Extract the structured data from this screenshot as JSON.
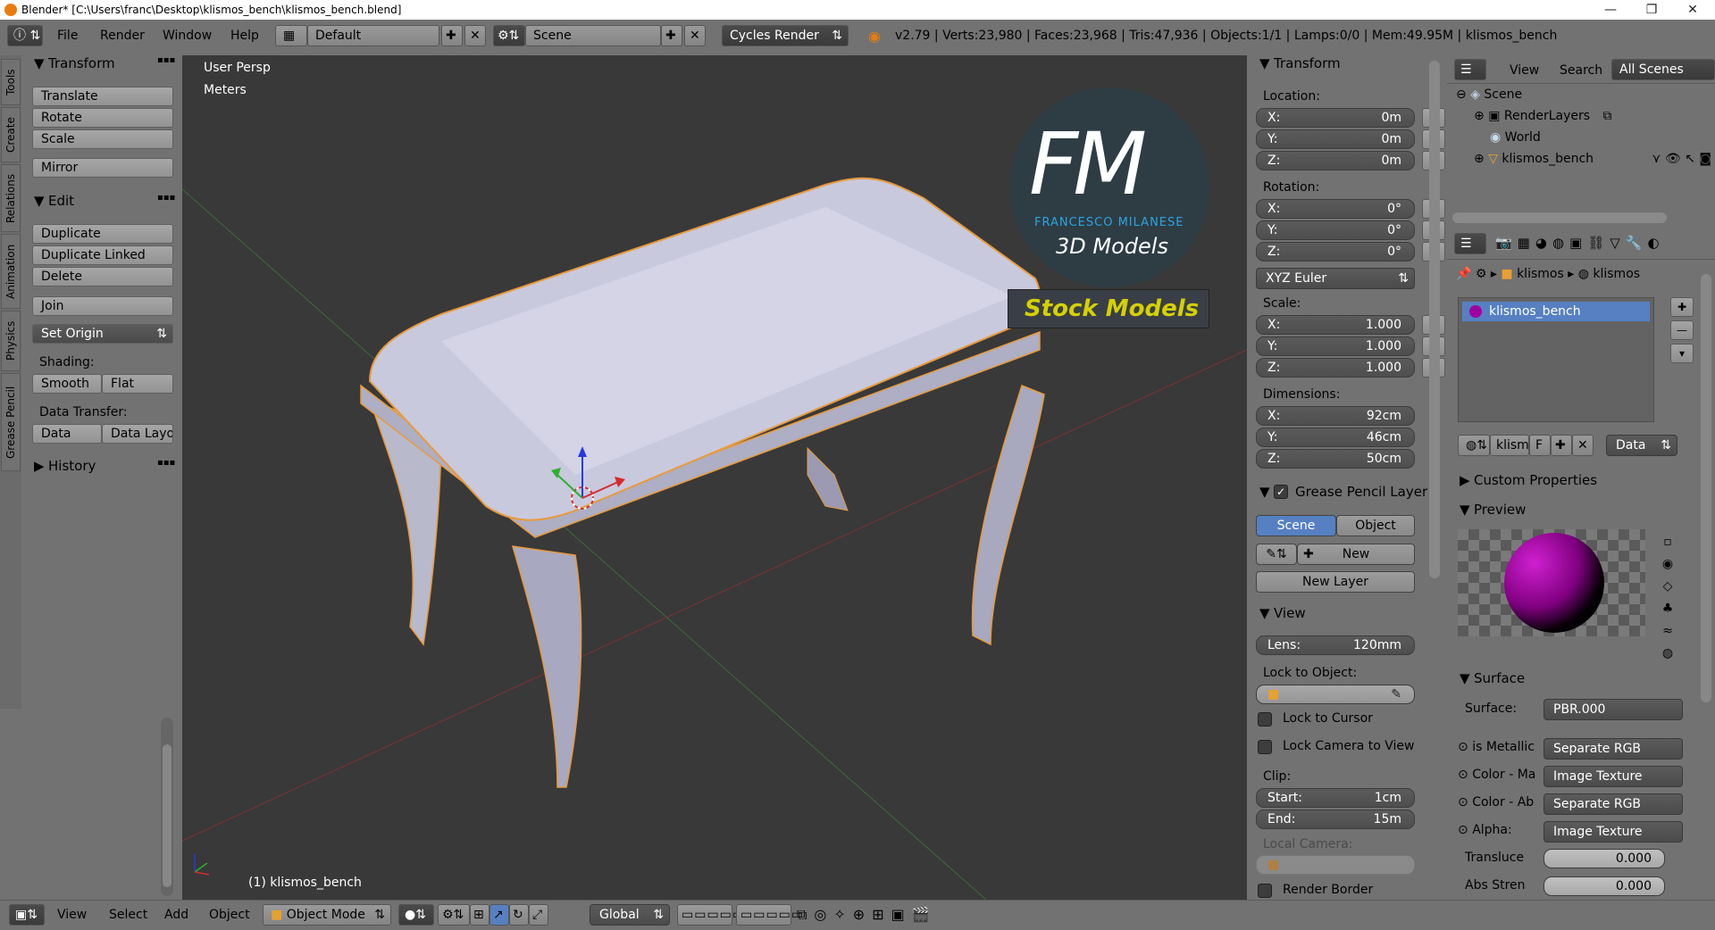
{
  "title_bar": {
    "text": "Blender* [C:\\Users\\franc\\Desktop\\klismos_bench\\klismos_bench.blend]"
  },
  "info_header": {
    "menus": [
      "File",
      "Render",
      "Window",
      "Help"
    ],
    "layout": "Default",
    "scene": "Scene",
    "engine": "Cycles Render",
    "stats": "v2.79 | Verts:23,980 | Faces:23,968 | Tris:47,936 | Objects:1/1 | Lamps:0/0 | Mem:49.95M | klismos_bench"
  },
  "tool_tabs": [
    "Tools",
    "Create",
    "Relations",
    "Animation",
    "Physics",
    "Grease Pencil"
  ],
  "toolshelf": {
    "transform_header": "Transform",
    "translate": "Translate",
    "rotate": "Rotate",
    "scale": "Scale",
    "mirror": "Mirror",
    "edit_header": "Edit",
    "duplicate": "Duplicate",
    "duplicate_linked": "Duplicate Linked",
    "delete": "Delete",
    "join": "Join",
    "set_origin": "Set Origin",
    "shading_label": "Shading:",
    "smooth": "Smooth",
    "flat": "Flat",
    "data_transfer_label": "Data Transfer:",
    "data": "Data",
    "data_layout": "Data Layo",
    "history_header": "History"
  },
  "viewport": {
    "view_name": "User Persp",
    "units": "Meters",
    "object_label": "(1) klismos_bench",
    "watermark_letters": "FM",
    "watermark_name": "FRANCESCO MILANESE",
    "watermark_sub": "3D Models",
    "watermark_banner": "Stock Models"
  },
  "n_panel": {
    "transform_header": "Transform",
    "location_label": "Location:",
    "location": [
      {
        "axis": "X:",
        "value": "0m"
      },
      {
        "axis": "Y:",
        "value": "0m"
      },
      {
        "axis": "Z:",
        "value": "0m"
      }
    ],
    "rotation_label": "Rotation:",
    "rotation": [
      {
        "axis": "X:",
        "value": "0°"
      },
      {
        "axis": "Y:",
        "value": "0°"
      },
      {
        "axis": "Z:",
        "value": "0°"
      }
    ],
    "rotation_mode": "XYZ Euler",
    "scale_label": "Scale:",
    "scale": [
      {
        "axis": "X:",
        "value": "1.000"
      },
      {
        "axis": "Y:",
        "value": "1.000"
      },
      {
        "axis": "Z:",
        "value": "1.000"
      }
    ],
    "dimensions_label": "Dimensions:",
    "dimensions": [
      {
        "axis": "X:",
        "value": "92cm"
      },
      {
        "axis": "Y:",
        "value": "46cm"
      },
      {
        "axis": "Z:",
        "value": "50cm"
      }
    ],
    "grease_header": "Grease Pencil Layer",
    "gp_scene": "Scene",
    "gp_object": "Object",
    "gp_new": "New",
    "gp_new_layer": "New Layer",
    "view_header": "View",
    "lens_label": "Lens:",
    "lens_value": "120mm",
    "lock_object_label": "Lock to Object:",
    "lock_cursor": "Lock to Cursor",
    "lock_camera": "Lock Camera to View",
    "clip_label": "Clip:",
    "clip_start_label": "Start:",
    "clip_start": "1cm",
    "clip_end_label": "End:",
    "clip_end": "15m",
    "local_camera_label": "Local Camera:",
    "render_border": "Render Border"
  },
  "outliner": {
    "view": "View",
    "search": "Search",
    "filter": "All Scenes",
    "items": [
      "Scene",
      "RenderLayers",
      "World",
      "klismos_bench"
    ]
  },
  "properties": {
    "breadcrumb_1": "klismos",
    "breadcrumb_2": "klismos",
    "material_slot": "klismos_bench",
    "mat_name": "klism",
    "mat_f": "F",
    "mat_link": "Data",
    "custom_props": "Custom Properties",
    "preview": "Preview",
    "surface_header": "Surface",
    "surface_label": "Surface:",
    "surface_value": "PBR.000",
    "inputs": [
      {
        "label": "is Metallic",
        "value": "Separate RGB"
      },
      {
        "label": "Color - Ma",
        "value": "Image Texture"
      },
      {
        "label": "Color - Ab",
        "value": "Separate RGB"
      },
      {
        "label": "Alpha:",
        "value": "Image Texture"
      }
    ],
    "translucent_label": "Transluce",
    "translucent_value": "0.000",
    "abs_label": "Abs Stren",
    "abs_value": "0.000"
  },
  "bottom_bar": {
    "view": "View",
    "select": "Select",
    "add": "Add",
    "object": "Object",
    "mode": "Object Mode",
    "orientation": "Global"
  },
  "colors": {
    "panel": "#727272",
    "viewport": "#393939",
    "selected": "#5680c2",
    "accent_blue": "#2aa6df",
    "banner_yellow": "#d5d100",
    "selection_orange": "#e89a3c"
  }
}
